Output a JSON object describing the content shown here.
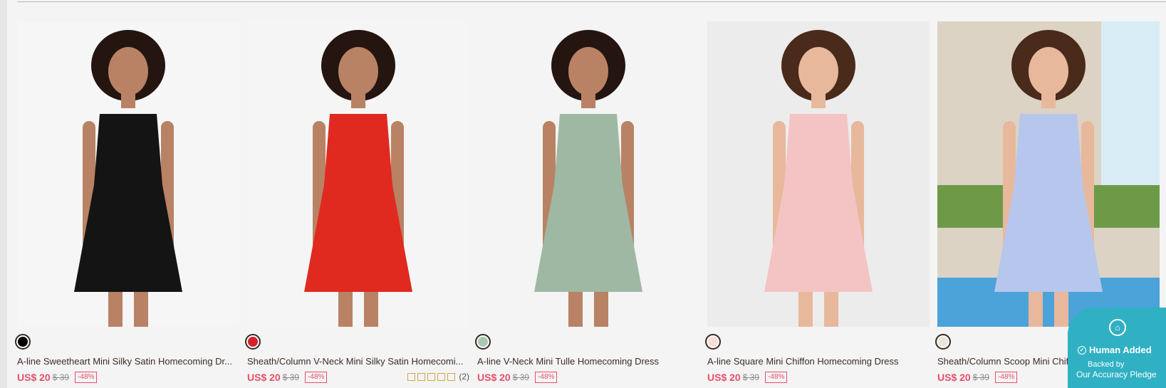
{
  "products": [
    {
      "title": "A-line Sweetheart Mini Silky Satin Homecoming Dr...",
      "price": "US$ 20",
      "old_price": "$ 39",
      "discount": "-48%",
      "swatch": "#000000",
      "dress_color": "#141414",
      "bg": "#f6f6f6",
      "rating": null
    },
    {
      "title": "Sheath/Column V-Neck Mini Silky Satin Homecomi...",
      "price": "US$ 20",
      "old_price": "$ 39",
      "discount": "-48%",
      "swatch": "#d8202a",
      "dress_color": "#e02a1f",
      "bg": "#f5f5f5",
      "rating": "(2)"
    },
    {
      "title": "A-line V-Neck Mini Tulle Homecoming Dress",
      "price": "US$ 20",
      "old_price": "$ 39",
      "discount": "-48%",
      "swatch": "#a9c8b2",
      "dress_color": "#9fb8a4",
      "bg": "#f4f4f4",
      "rating": null
    },
    {
      "title": "A-line Square Mini Chiffon Homecoming Dress",
      "price": "US$ 20",
      "old_price": "$ 39",
      "discount": "-48%",
      "swatch": "#f7ddd6",
      "dress_color": "#f4c4c4",
      "bg": "#ececec",
      "rating": null
    },
    {
      "title": "Sheath/Column Scoop Mini Chiffon Homecoming Dress",
      "price": "US$ 20",
      "old_price": "$ 39",
      "discount": "-48%",
      "swatch": "#efe4da",
      "dress_color": "#b7c6ec",
      "bg": "#dcd3c4",
      "rating": null
    }
  ],
  "badge": {
    "icon": "graduation-cap-icon",
    "line1": "Human Added",
    "line2": "Backed by",
    "line3": "Our Accuracy Pledge"
  }
}
